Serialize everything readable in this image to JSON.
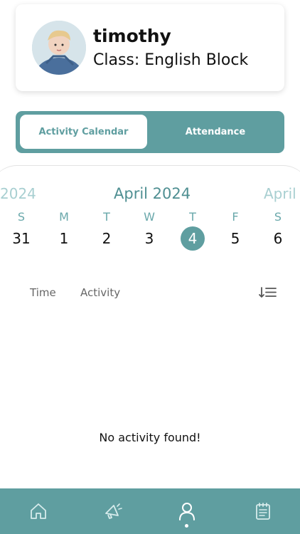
{
  "profile": {
    "name": "timothy",
    "class_label": "Class: English Block",
    "avatar_icon": "student-photo"
  },
  "tabs": [
    {
      "label": "Activity Calendar",
      "active": true
    },
    {
      "label": "Attendance",
      "active": false
    }
  ],
  "calendar": {
    "prev_month": "2024",
    "current_month": "April 2024",
    "next_month": "April",
    "weekdays": [
      "S",
      "M",
      "T",
      "W",
      "T",
      "F",
      "S"
    ],
    "dates": [
      "31",
      "1",
      "2",
      "3",
      "4",
      "5",
      "6"
    ],
    "selected_date": "4"
  },
  "activity_table": {
    "columns": [
      "Time",
      "Activity"
    ],
    "sort_icon": "sort-list-icon",
    "empty_message": "No activity found!"
  },
  "bottom_nav": {
    "items": [
      "home-icon",
      "megaphone-icon",
      "profile-icon",
      "notepad-icon"
    ],
    "active": "profile-icon"
  },
  "colors": {
    "accent": "#5f9ea0",
    "accent_light": "#a8cfd1",
    "text": "#111111"
  }
}
